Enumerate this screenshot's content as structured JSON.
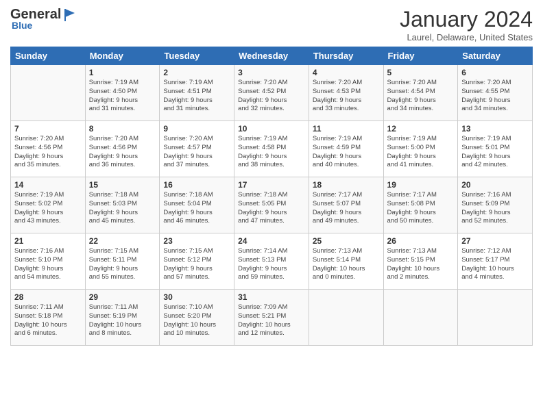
{
  "header": {
    "logo_general": "General",
    "logo_blue": "Blue",
    "month_title": "January 2024",
    "subtitle": "Laurel, Delaware, United States"
  },
  "days_of_week": [
    "Sunday",
    "Monday",
    "Tuesday",
    "Wednesday",
    "Thursday",
    "Friday",
    "Saturday"
  ],
  "weeks": [
    [
      {
        "day": "",
        "details": ""
      },
      {
        "day": "1",
        "details": "Sunrise: 7:19 AM\nSunset: 4:50 PM\nDaylight: 9 hours\nand 31 minutes."
      },
      {
        "day": "2",
        "details": "Sunrise: 7:19 AM\nSunset: 4:51 PM\nDaylight: 9 hours\nand 31 minutes."
      },
      {
        "day": "3",
        "details": "Sunrise: 7:20 AM\nSunset: 4:52 PM\nDaylight: 9 hours\nand 32 minutes."
      },
      {
        "day": "4",
        "details": "Sunrise: 7:20 AM\nSunset: 4:53 PM\nDaylight: 9 hours\nand 33 minutes."
      },
      {
        "day": "5",
        "details": "Sunrise: 7:20 AM\nSunset: 4:54 PM\nDaylight: 9 hours\nand 34 minutes."
      },
      {
        "day": "6",
        "details": "Sunrise: 7:20 AM\nSunset: 4:55 PM\nDaylight: 9 hours\nand 34 minutes."
      }
    ],
    [
      {
        "day": "7",
        "details": "Sunrise: 7:20 AM\nSunset: 4:56 PM\nDaylight: 9 hours\nand 35 minutes."
      },
      {
        "day": "8",
        "details": "Sunrise: 7:20 AM\nSunset: 4:56 PM\nDaylight: 9 hours\nand 36 minutes."
      },
      {
        "day": "9",
        "details": "Sunrise: 7:20 AM\nSunset: 4:57 PM\nDaylight: 9 hours\nand 37 minutes."
      },
      {
        "day": "10",
        "details": "Sunrise: 7:19 AM\nSunset: 4:58 PM\nDaylight: 9 hours\nand 38 minutes."
      },
      {
        "day": "11",
        "details": "Sunrise: 7:19 AM\nSunset: 4:59 PM\nDaylight: 9 hours\nand 40 minutes."
      },
      {
        "day": "12",
        "details": "Sunrise: 7:19 AM\nSunset: 5:00 PM\nDaylight: 9 hours\nand 41 minutes."
      },
      {
        "day": "13",
        "details": "Sunrise: 7:19 AM\nSunset: 5:01 PM\nDaylight: 9 hours\nand 42 minutes."
      }
    ],
    [
      {
        "day": "14",
        "details": "Sunrise: 7:19 AM\nSunset: 5:02 PM\nDaylight: 9 hours\nand 43 minutes."
      },
      {
        "day": "15",
        "details": "Sunrise: 7:18 AM\nSunset: 5:03 PM\nDaylight: 9 hours\nand 45 minutes."
      },
      {
        "day": "16",
        "details": "Sunrise: 7:18 AM\nSunset: 5:04 PM\nDaylight: 9 hours\nand 46 minutes."
      },
      {
        "day": "17",
        "details": "Sunrise: 7:18 AM\nSunset: 5:05 PM\nDaylight: 9 hours\nand 47 minutes."
      },
      {
        "day": "18",
        "details": "Sunrise: 7:17 AM\nSunset: 5:07 PM\nDaylight: 9 hours\nand 49 minutes."
      },
      {
        "day": "19",
        "details": "Sunrise: 7:17 AM\nSunset: 5:08 PM\nDaylight: 9 hours\nand 50 minutes."
      },
      {
        "day": "20",
        "details": "Sunrise: 7:16 AM\nSunset: 5:09 PM\nDaylight: 9 hours\nand 52 minutes."
      }
    ],
    [
      {
        "day": "21",
        "details": "Sunrise: 7:16 AM\nSunset: 5:10 PM\nDaylight: 9 hours\nand 54 minutes."
      },
      {
        "day": "22",
        "details": "Sunrise: 7:15 AM\nSunset: 5:11 PM\nDaylight: 9 hours\nand 55 minutes."
      },
      {
        "day": "23",
        "details": "Sunrise: 7:15 AM\nSunset: 5:12 PM\nDaylight: 9 hours\nand 57 minutes."
      },
      {
        "day": "24",
        "details": "Sunrise: 7:14 AM\nSunset: 5:13 PM\nDaylight: 9 hours\nand 59 minutes."
      },
      {
        "day": "25",
        "details": "Sunrise: 7:13 AM\nSunset: 5:14 PM\nDaylight: 10 hours\nand 0 minutes."
      },
      {
        "day": "26",
        "details": "Sunrise: 7:13 AM\nSunset: 5:15 PM\nDaylight: 10 hours\nand 2 minutes."
      },
      {
        "day": "27",
        "details": "Sunrise: 7:12 AM\nSunset: 5:17 PM\nDaylight: 10 hours\nand 4 minutes."
      }
    ],
    [
      {
        "day": "28",
        "details": "Sunrise: 7:11 AM\nSunset: 5:18 PM\nDaylight: 10 hours\nand 6 minutes."
      },
      {
        "day": "29",
        "details": "Sunrise: 7:11 AM\nSunset: 5:19 PM\nDaylight: 10 hours\nand 8 minutes."
      },
      {
        "day": "30",
        "details": "Sunrise: 7:10 AM\nSunset: 5:20 PM\nDaylight: 10 hours\nand 10 minutes."
      },
      {
        "day": "31",
        "details": "Sunrise: 7:09 AM\nSunset: 5:21 PM\nDaylight: 10 hours\nand 12 minutes."
      },
      {
        "day": "",
        "details": ""
      },
      {
        "day": "",
        "details": ""
      },
      {
        "day": "",
        "details": ""
      }
    ]
  ]
}
